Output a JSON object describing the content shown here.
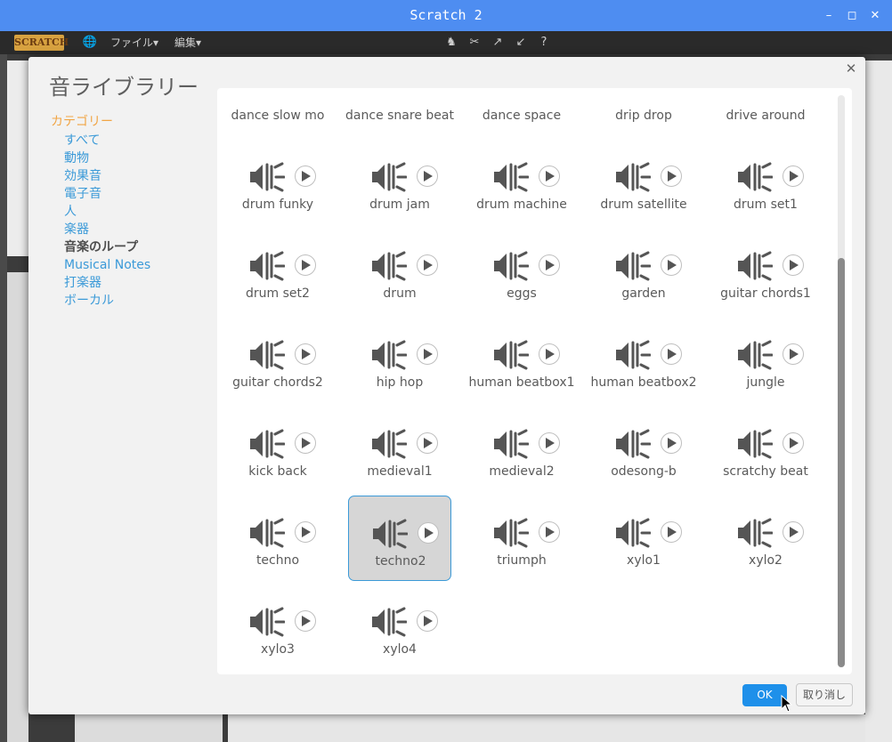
{
  "window": {
    "title": "Scratch 2"
  },
  "menubar": {
    "logo": "SCRATCH",
    "file": "ファイル▾",
    "edit": "編集▾"
  },
  "dialog": {
    "title": "音ライブラリー",
    "category_header": "カテゴリー",
    "categories": [
      {
        "label": "すべて"
      },
      {
        "label": "動物"
      },
      {
        "label": "効果音"
      },
      {
        "label": "電子音"
      },
      {
        "label": "人"
      },
      {
        "label": "楽器"
      },
      {
        "label": "音楽のループ",
        "active": true
      },
      {
        "label": "Musical Notes"
      },
      {
        "label": "打楽器"
      },
      {
        "label": "ボーカル"
      }
    ],
    "sounds_top_partial": [
      "dance slow mo",
      "dance snare beat",
      "dance space",
      "drip drop",
      "drive around"
    ],
    "sounds": [
      "drum funky",
      "drum jam",
      "drum machine",
      "drum satellite",
      "drum set1",
      "drum set2",
      "drum",
      "eggs",
      "garden",
      "guitar chords1",
      "guitar chords2",
      "hip hop",
      "human beatbox1",
      "human beatbox2",
      "jungle",
      "kick back",
      "medieval1",
      "medieval2",
      "odesong-b",
      "scratchy beat",
      "techno",
      "techno2",
      "triumph",
      "xylo1",
      "xylo2",
      "xylo3",
      "xylo4"
    ],
    "selected_sound": "techno2",
    "ok_label": "OK",
    "cancel_label": "取り消し",
    "icons": {
      "sound": "speaker-icon",
      "play": "play-icon",
      "close": "close-icon"
    }
  },
  "colors": {
    "titlebar": "#4e8df1",
    "accent": "#1e90ea",
    "category_header": "#f1a545",
    "link": "#3b9ad8"
  }
}
